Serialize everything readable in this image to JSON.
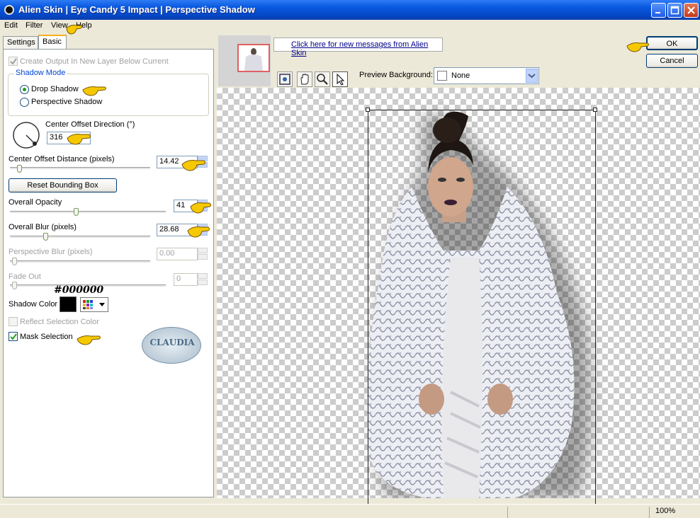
{
  "window": {
    "title": "Alien Skin | Eye Candy 5 Impact | Perspective Shadow"
  },
  "menu": [
    "Edit",
    "Filter",
    "View",
    "Help"
  ],
  "tabs": [
    "Settings",
    "Basic"
  ],
  "basic": {
    "create_output_label": "Create Output In New Layer Below Current",
    "shadow_mode_legend": "Shadow Mode",
    "drop_shadow_label": "Drop Shadow",
    "perspective_shadow_label": "Perspective Shadow",
    "center_offset_direction_label": "Center Offset Direction (°)",
    "center_offset_direction_value": "316",
    "center_offset_distance_label": "Center Offset Distance (pixels)",
    "center_offset_distance_value": "14.42",
    "reset_bounding_box_label": "Reset Bounding Box",
    "overall_opacity_label": "Overall Opacity",
    "overall_opacity_value": "41",
    "overall_blur_label": "Overall Blur (pixels)",
    "overall_blur_value": "28.68",
    "perspective_blur_label": "Perspective Blur (pixels)",
    "perspective_blur_value": "0.00",
    "fade_out_label": "Fade Out",
    "fade_out_value": "0",
    "shadow_color_hex_annotation": "#000000",
    "shadow_color_label": "Shadow Color",
    "shadow_color": "#000000",
    "reflect_selection_color_label": "Reflect Selection Color",
    "mask_selection_label": "Mask Selection",
    "watermark_text": "CLAUDIA"
  },
  "messages_link": "Click here for new messages from Alien Skin",
  "preview_background_label": "Preview Background:",
  "preview_background_value": "None",
  "ok_label": "OK",
  "cancel_label": "Cancel",
  "zoom_level": "100%",
  "colors": {
    "accent_pointer": "#f6c800",
    "titlebar": "#0a5ae0"
  }
}
